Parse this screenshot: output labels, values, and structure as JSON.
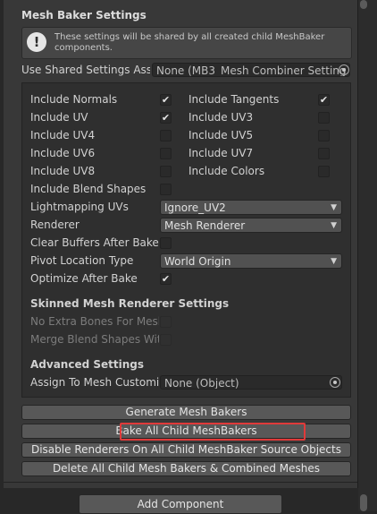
{
  "header": {
    "title": "Mesh Baker Settings"
  },
  "info": {
    "message": "These settings will be shared by all created child MeshBaker components."
  },
  "shared": {
    "label": "Use Shared Settings Asse",
    "value": "None (MB3_Mesh Combiner Setting"
  },
  "options": {
    "include_normals": "Include Normals",
    "include_uv": "Include UV",
    "include_uv4": "Include UV4",
    "include_uv6": "Include UV6",
    "include_uv8": "Include UV8",
    "include_tangents": "Include Tangents",
    "include_uv3": "Include UV3",
    "include_uv5": "Include UV5",
    "include_uv7": "Include UV7",
    "include_colors": "Include Colors",
    "include_blend_shapes": "Include Blend Shapes",
    "lightmapping_uvs": "Lightmapping UVs",
    "lightmapping_value": "Ignore_UV2",
    "renderer": "Renderer",
    "renderer_value": "Mesh Renderer",
    "clear_buffers": "Clear Buffers After Bake",
    "pivot_location": "Pivot Location Type",
    "pivot_value": "World Origin",
    "optimize_after_bake": "Optimize After Bake",
    "check": "✔"
  },
  "skinned": {
    "title": "Skinned Mesh Renderer Settings",
    "no_extra_bones": "No Extra Bones For Mesh",
    "merge_blend": "Merge Blend Shapes With"
  },
  "advanced": {
    "title": "Advanced Settings",
    "assign_label": "Assign To Mesh Customi:",
    "assign_value": "None (Object)"
  },
  "buttons": {
    "generate": "Generate Mesh Bakers",
    "bake_all": "Bake All Child MeshBakers",
    "disable_renderers": "Disable Renderers On All Child MeshBaker Source Objects",
    "delete_all": "Delete All Child Mesh Bakers & Combined Meshes"
  },
  "footer": {
    "add_component": "Add Component"
  },
  "icons": {
    "info": "warning-icon",
    "picker": "object-picker-icon",
    "dropdown": "dropdown-arrow-icon"
  },
  "colors": {
    "highlight": "#e03a3a"
  }
}
